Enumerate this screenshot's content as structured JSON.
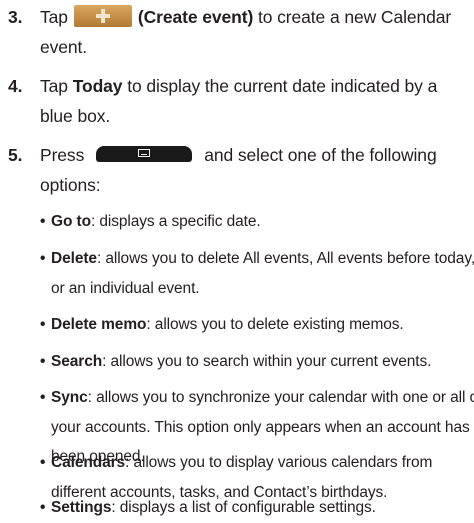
{
  "steps": [
    {
      "number": "3.",
      "pre": "Tap",
      "icon": "plus-icon",
      "bold": "(Create event)",
      "post_line1": " to create a new Calendar",
      "line2": "event."
    },
    {
      "number": "4.",
      "pre": "Tap ",
      "bold": "Today",
      "post_line1": " to display the current date indicated by a",
      "line2": "blue box."
    },
    {
      "number": "5.",
      "pre": "Press",
      "icon": "menu-key-icon",
      "post_line1": "and select one of the following",
      "line2": "options:"
    }
  ],
  "options": [
    {
      "term": "Go to",
      "lines": [
        ": displays a specific date."
      ]
    },
    {
      "term": "Delete",
      "lines": [
        ": allows you to delete All events, All events before today,",
        "or an individual event."
      ]
    },
    {
      "term": "Delete memo",
      "lines": [
        ": allows you to delete existing memos."
      ]
    },
    {
      "term": "Search",
      "lines": [
        ": allows you to search within your current events."
      ]
    },
    {
      "term": "Sync",
      "lines": [
        ": allows you to synchronize your calendar with one or all of",
        "your accounts. This option only appears when an account has",
        "been opened."
      ]
    },
    {
      "term": "Calendars",
      "lines": [
        ": allows you to display various calendars from",
        "different accounts, tasks, and Contact’s birthdays."
      ]
    },
    {
      "term": "Settings",
      "lines": [
        ": displays a list of configurable settings."
      ]
    }
  ],
  "bullet_symbol": "•",
  "colors": {
    "text": "#231f20",
    "create_button": "#c48c45",
    "menu_key": "#1a1a1a"
  }
}
